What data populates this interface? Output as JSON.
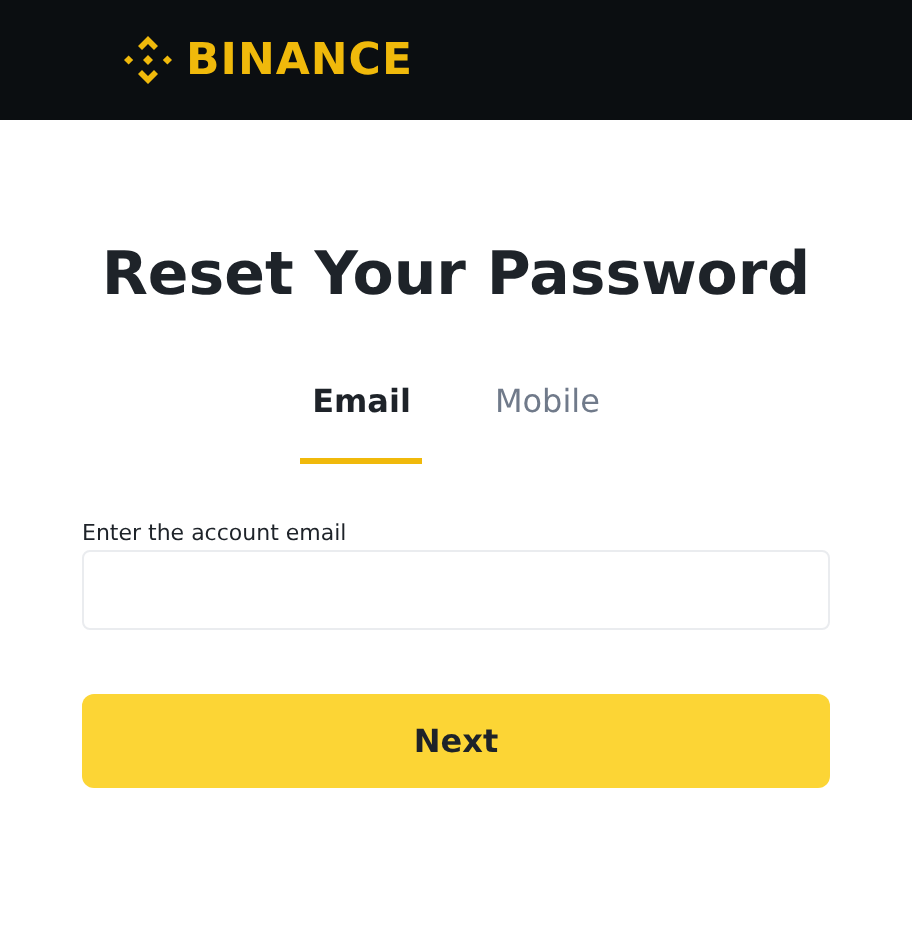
{
  "header": {
    "logo_text": "BINANCE"
  },
  "title": "Reset Your Password",
  "tabs": [
    {
      "label": "Email",
      "selected": true
    },
    {
      "label": "Mobile",
      "selected": false
    }
  ],
  "field": {
    "label": "Enter the account email"
  },
  "button": "Next"
}
